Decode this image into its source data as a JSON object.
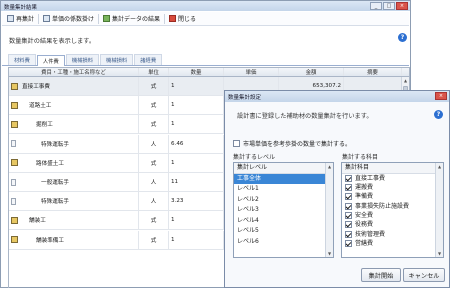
{
  "main_window": {
    "title": "数量集計結果",
    "toolbar": {
      "recalc": "再集計",
      "unit_price_clear": "単価の係数掛け",
      "aggregate_result": "集計データの結果",
      "close": "閉じる"
    },
    "message": "数量集計の結果を表示します。",
    "tabs": [
      "材料費",
      "人件費",
      "機械損料",
      "機械損料",
      "諸経費"
    ],
    "active_tab_index": 1,
    "columns": [
      "費目・工種・施工名称など",
      "単位",
      "数量",
      "単価",
      "金額",
      "摘要"
    ],
    "rows": [
      {
        "name": "直接工事費",
        "unit": "式",
        "qty": "1",
        "price": "",
        "amount": "653,307.2",
        "note": "",
        "icon": "folder",
        "indent": 0,
        "highlight": true
      },
      {
        "name": "道路土工",
        "unit": "式",
        "qty": "1",
        "price": "",
        "amount": "",
        "note": "",
        "icon": "folder",
        "indent": 1
      },
      {
        "name": "掘削工",
        "unit": "式",
        "qty": "1",
        "price": "",
        "amount": "",
        "note": "",
        "icon": "folder",
        "indent": 2
      },
      {
        "name": "特殊運転手",
        "unit": "人",
        "qty": "6.46",
        "price": "",
        "amount": "",
        "note": "",
        "icon": "doc",
        "indent": 3
      },
      {
        "name": "路体盛土工",
        "unit": "式",
        "qty": "1",
        "price": "",
        "amount": "",
        "note": "",
        "icon": "folder",
        "indent": 2
      },
      {
        "name": "一般運転手",
        "unit": "人",
        "qty": "11",
        "price": "",
        "amount": "",
        "note": "",
        "icon": "doc",
        "indent": 3
      },
      {
        "name": "特殊運転手",
        "unit": "人",
        "qty": "3.23",
        "price": "",
        "amount": "",
        "note": "",
        "icon": "doc",
        "indent": 3
      },
      {
        "name": "舗装工",
        "unit": "式",
        "qty": "1",
        "price": "",
        "amount": "",
        "note": "",
        "icon": "folder",
        "indent": 1
      },
      {
        "name": "舗装準備工",
        "unit": "式",
        "qty": "1",
        "price": "",
        "amount": "",
        "note": "",
        "icon": "folder",
        "indent": 2
      }
    ]
  },
  "dialog": {
    "title": "数量集計設定",
    "message": "設計書に登録した補助材の数量集計を行います。",
    "option_label": "市場単価を参考歩掛の数量で集計する。",
    "option_checked": false,
    "level_group_label": "集計するレベル",
    "level_header": "集計レベル",
    "levels": [
      "工事全体",
      "レベル1",
      "レベル2",
      "レベル3",
      "レベル4",
      "レベル5",
      "レベル6"
    ],
    "selected_level_index": 0,
    "items_group_label": "集計する科目",
    "items_header": "集計科目",
    "items": [
      {
        "label": "直接工事費",
        "checked": true
      },
      {
        "label": "運搬費",
        "checked": true
      },
      {
        "label": "準備費",
        "checked": true
      },
      {
        "label": "事業損失防止施設費",
        "checked": true
      },
      {
        "label": "安全費",
        "checked": true
      },
      {
        "label": "役務費",
        "checked": true
      },
      {
        "label": "技術管理費",
        "checked": true
      },
      {
        "label": "営繕費",
        "checked": true
      }
    ],
    "start_button": "集計開始",
    "cancel_button": "キャンセル"
  }
}
